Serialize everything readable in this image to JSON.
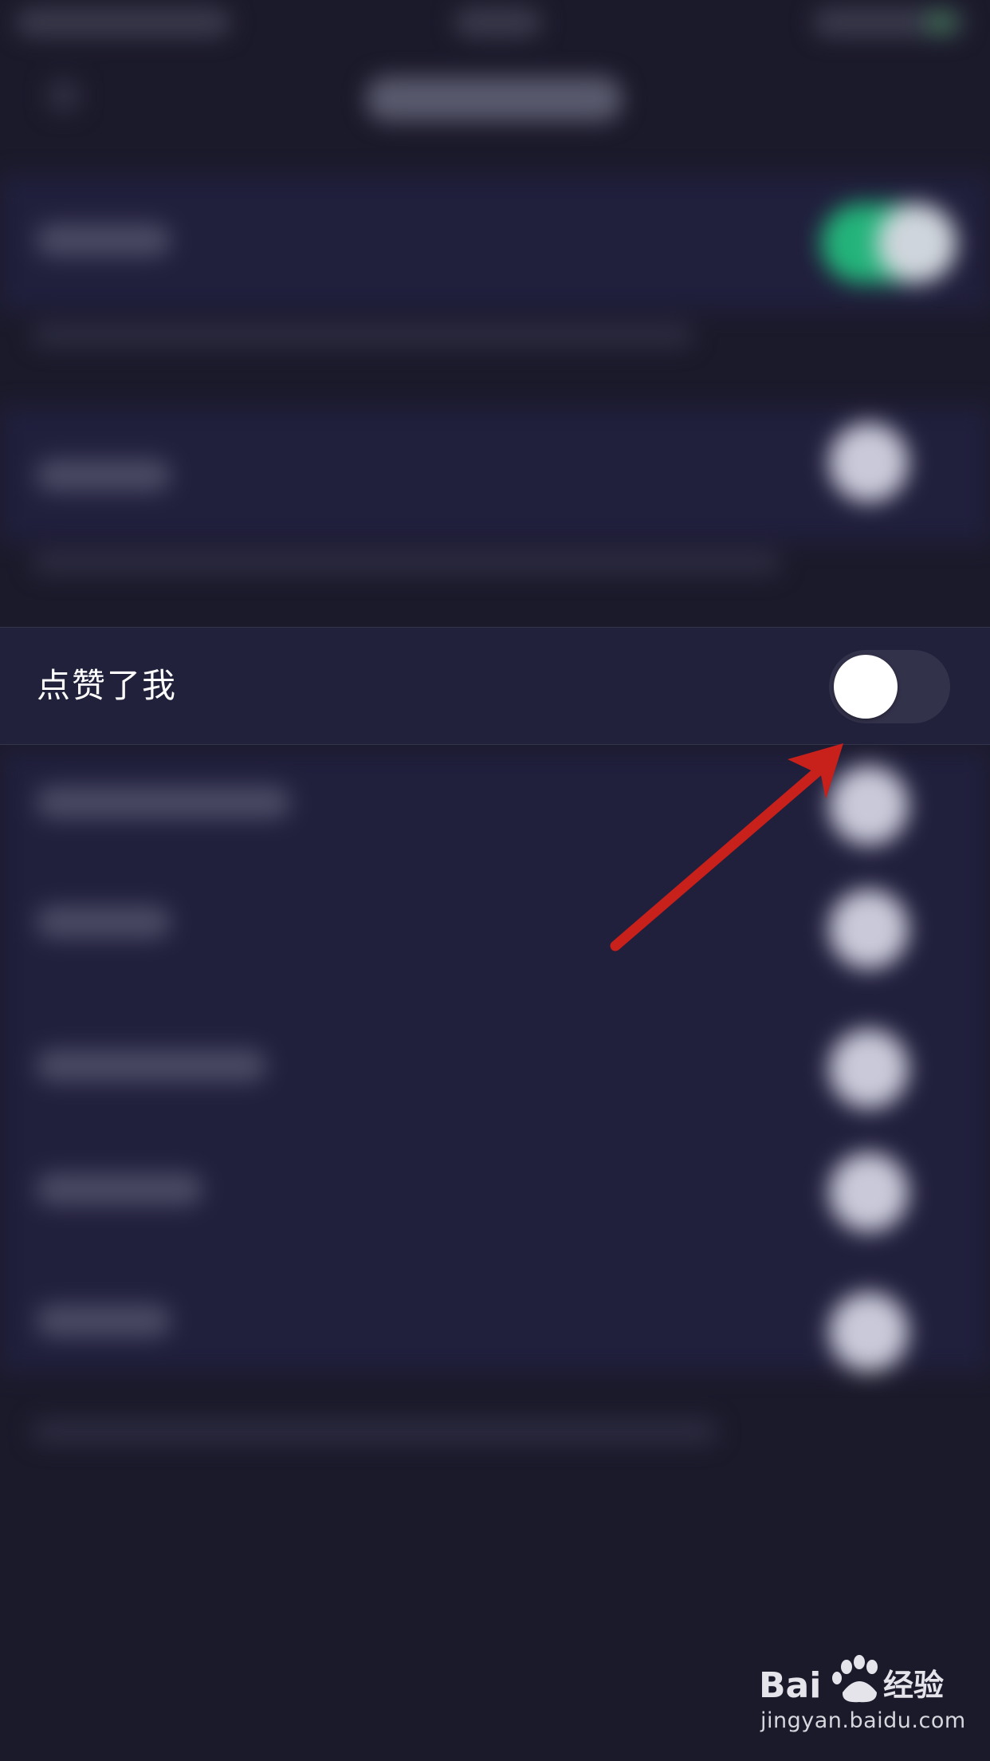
{
  "focused_setting": {
    "label": "点赞了我",
    "enabled": false
  },
  "watermark": {
    "brand": "Bai",
    "brand_suffix": "经验",
    "url": "jingyan.baidu.com"
  },
  "colors": {
    "background": "#1b1a2b",
    "row_background": "#21213b",
    "toggle_track_off": "#33324b",
    "toggle_on": "#23b37a",
    "knob": "#ffffff",
    "arrow": "#c8201a",
    "text": "#ffffff"
  },
  "icons": [
    "red-annotation-arrow-icon",
    "baidu-paw-icon"
  ]
}
